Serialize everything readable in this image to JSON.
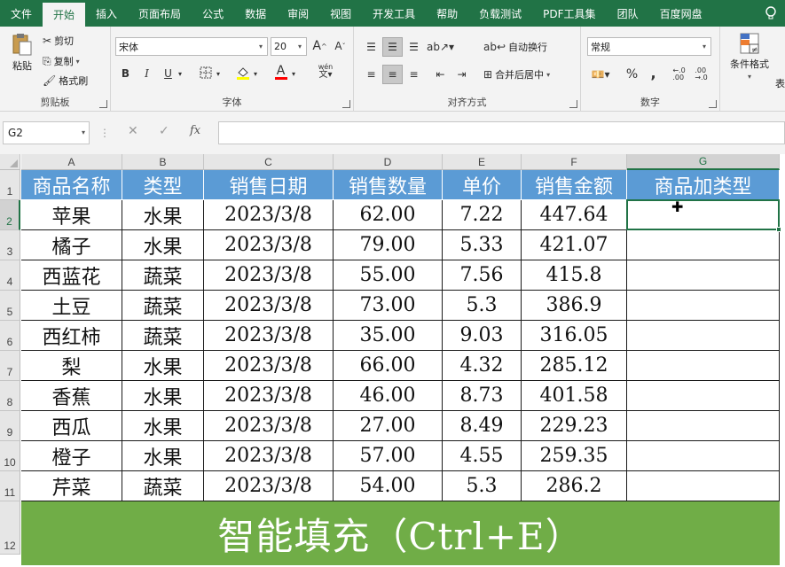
{
  "ribbon": {
    "tabs": [
      "文件",
      "开始",
      "插入",
      "页面布局",
      "公式",
      "数据",
      "审阅",
      "视图",
      "开发工具",
      "帮助",
      "负载测试",
      "PDF工具集",
      "团队",
      "百度网盘"
    ],
    "active_tab": "开始",
    "clipboard": {
      "paste": "粘贴",
      "cut": "剪切",
      "copy": "复制",
      "format_painter": "格式刷",
      "label": "剪贴板"
    },
    "font": {
      "name": "宋体",
      "size": "20",
      "label": "字体",
      "bold": "B",
      "italic": "I",
      "underline": "U",
      "wen": "wén",
      "grow": "A",
      "shrink": "A",
      "font_color": "A"
    },
    "alignment": {
      "wrap": "自动换行",
      "merge": "合并后居中",
      "label": "对齐方式"
    },
    "number": {
      "format": "常规",
      "percent": "%",
      "comma": ",",
      "label": "数字",
      "currency_icon": "currency-icon"
    },
    "styles": {
      "conditional": "条件格式",
      "table_format_partial": "表"
    }
  },
  "formula_bar": {
    "name_box": "G2",
    "cancel": "✕",
    "enter": "✓",
    "fx": "fx",
    "value": ""
  },
  "sheet": {
    "columns": [
      "A",
      "B",
      "C",
      "D",
      "E",
      "F",
      "G"
    ],
    "selected_column": "G",
    "rows": [
      "1",
      "2",
      "3",
      "4",
      "5",
      "6",
      "7",
      "8",
      "9",
      "10",
      "11",
      "12"
    ],
    "selected_row": "2",
    "header": [
      "商品名称",
      "类型",
      "销售日期",
      "销售数量",
      "单价",
      "销售金额",
      "商品加类型"
    ],
    "data": [
      [
        "苹果",
        "水果",
        "2023/3/8",
        "62.00",
        "7.22",
        "447.64",
        ""
      ],
      [
        "橘子",
        "水果",
        "2023/3/8",
        "79.00",
        "5.33",
        "421.07",
        ""
      ],
      [
        "西蓝花",
        "蔬菜",
        "2023/3/8",
        "55.00",
        "7.56",
        "415.8",
        ""
      ],
      [
        "土豆",
        "蔬菜",
        "2023/3/8",
        "73.00",
        "5.3",
        "386.9",
        ""
      ],
      [
        "西红柿",
        "蔬菜",
        "2023/3/8",
        "35.00",
        "9.03",
        "316.05",
        ""
      ],
      [
        "梨",
        "水果",
        "2023/3/8",
        "66.00",
        "4.32",
        "285.12",
        ""
      ],
      [
        "香蕉",
        "水果",
        "2023/3/8",
        "46.00",
        "8.73",
        "401.58",
        ""
      ],
      [
        "西瓜",
        "水果",
        "2023/3/8",
        "27.00",
        "8.49",
        "229.23",
        ""
      ],
      [
        "橙子",
        "水果",
        "2023/3/8",
        "57.00",
        "4.55",
        "259.35",
        ""
      ],
      [
        "芹菜",
        "蔬菜",
        "2023/3/8",
        "54.00",
        "5.3",
        "286.2",
        ""
      ]
    ],
    "banner": "智能填充（Ctrl+E）",
    "colors": {
      "header_fill": "#5b9bd5",
      "banner_fill": "#70ad47",
      "accent": "#217346"
    }
  }
}
